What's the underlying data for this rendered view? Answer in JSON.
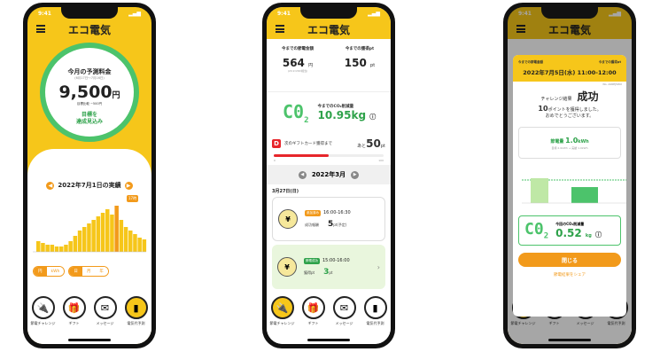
{
  "common": {
    "time": "9:41",
    "app_title": "エコ電気",
    "nav": [
      {
        "label": "節電チャレンジ",
        "icon": "plug-icon"
      },
      {
        "label": "ギフト",
        "icon": "gift-icon"
      },
      {
        "label": "メッセージ",
        "icon": "mail-icon"
      },
      {
        "label": "電気代予測",
        "icon": "bar-chart-icon"
      }
    ]
  },
  "phone1": {
    "gauge_label": "今月の予測料金",
    "gauge_period": "(6月17日〜7月16日)",
    "amount": "9,500",
    "amount_unit": "円",
    "target_diff": "目標比較 −500円",
    "status_line1": "目標を",
    "status_line2": "達成見込み",
    "date_label": "2022年7月1日の実績",
    "highlight": "17時",
    "toggles_unit": [
      "円",
      "kWh"
    ],
    "toggles_period": [
      "日",
      "月",
      "年"
    ]
  },
  "phone2": {
    "saving_title": "今までの節電金額",
    "saving_value": "564",
    "saving_unit": "円",
    "saving_sub": "(20.9 kWh相当)",
    "points_title": "今までの獲得pt",
    "points_value": "150",
    "points_unit": "pt",
    "co2_title": "今までのCO₂削減量",
    "co2_value": "10.95kg",
    "gift_text": "次のギフトカード獲得まで",
    "gift_prefix": "あと",
    "gift_remaining": "50",
    "gift_unit": "pt",
    "progress": 0.5,
    "progress_min": "0",
    "progress_max": "100",
    "month": "2022年3月",
    "day": "3月27日(日)",
    "history": [
      {
        "badge": "参加済み",
        "time": "16:00-16:30",
        "label": "成功報酬",
        "value": "5",
        "unit": "pt(予定)",
        "tag": "成功"
      },
      {
        "badge": "節電成功",
        "time": "15:00-16:00",
        "label": "獲得pt",
        "value": "3",
        "unit": "pt",
        "tag": "成功"
      }
    ]
  },
  "phone3": {
    "header_left": "今までの節電金額",
    "header_right": "今までの獲得pt",
    "datetime": "2022年7月5日(水) 11:00-12:00",
    "number": "No. A00EJ5WX",
    "challenge_label": "チャレンジ結果",
    "challenge_result": "成功",
    "points_got": "10",
    "points_msg": "ポイントを獲得しました。",
    "congrats": "おめでとうございます。",
    "saved_label": "節電量",
    "saved_value": "1.0",
    "saved_unit": "kWh",
    "saved_sub": "目標 2.0kWh → 実績 1.0kWh",
    "co2_title": "今回のCO₂削減量",
    "co2_value": "0.52",
    "co2_unit": "kg",
    "close": "閉じる",
    "share": "節電結果をシェア"
  }
}
